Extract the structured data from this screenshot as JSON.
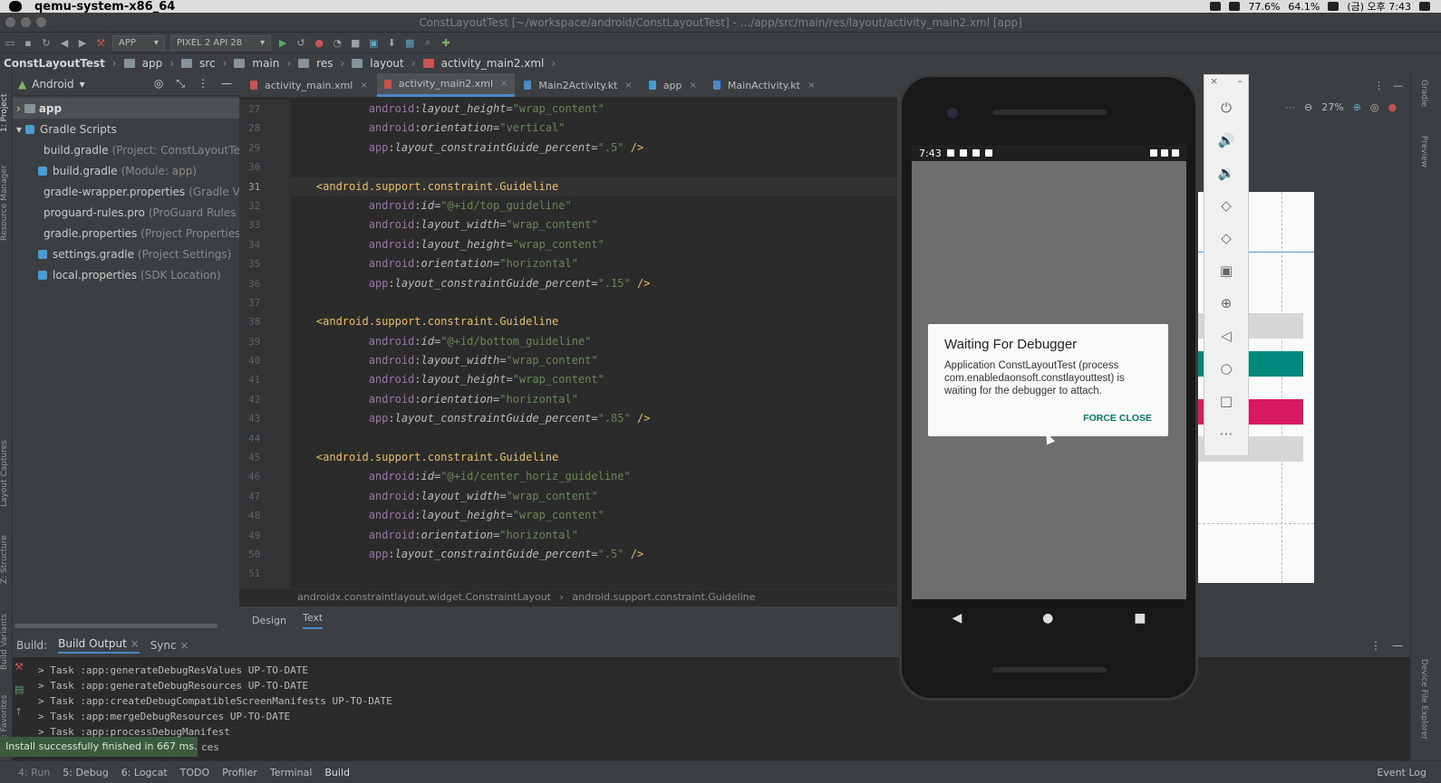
{
  "mac_menubar": {
    "app_name": "qemu-system-x86_64",
    "cpu": "77.6%",
    "mem": "64.1%",
    "clock": "(금) 오후 7:43"
  },
  "window": {
    "title": "ConstLayoutTest [~/workspace/android/ConstLayoutTest] - .../app/src/main/res/layout/activity_main2.xml [app]"
  },
  "toolbar": {
    "run_config": "APP",
    "device": "PIXEL 2 API 28"
  },
  "navbar": {
    "items": [
      "ConstLayoutTest",
      "app",
      "src",
      "main",
      "res",
      "layout",
      "activity_main2.xml"
    ]
  },
  "left_tools": {
    "project": "1: Project",
    "resource_manager": "Resource Manager",
    "layout_captures": "Layout Captures",
    "structure": "Z: Structure",
    "build_variants": "Build Variants",
    "favorites": "2: Favorites"
  },
  "project_panel": {
    "view": "Android",
    "tree": [
      {
        "label": "app",
        "hint": "",
        "sel": true
      },
      {
        "label": "Gradle Scripts",
        "hint": ""
      },
      {
        "label": "build.gradle",
        "hint": "(Project: ConstLayoutTest)"
      },
      {
        "label": "build.gradle",
        "hint": "(Module: app)"
      },
      {
        "label": "gradle-wrapper.properties",
        "hint": "(Gradle Versi"
      },
      {
        "label": "proguard-rules.pro",
        "hint": "(ProGuard Rules for a"
      },
      {
        "label": "gradle.properties",
        "hint": "(Project Properties)"
      },
      {
        "label": "settings.gradle",
        "hint": "(Project Settings)"
      },
      {
        "label": "local.properties",
        "hint": "(SDK Location)"
      }
    ]
  },
  "editor": {
    "tabs": [
      "activity_main.xml",
      "activity_main2.xml",
      "Main2Activity.kt",
      "app",
      "MainActivity.kt"
    ],
    "active_tab": 1,
    "line_numbers": [
      "27",
      "28",
      "29",
      "30",
      "31",
      "32",
      "33",
      "34",
      "35",
      "36",
      "37",
      "38",
      "39",
      "40",
      "41",
      "42",
      "43",
      "44",
      "45",
      "46",
      "47",
      "48",
      "49",
      "50",
      "51"
    ],
    "code": [
      {
        "indent": 1,
        "kind": "attr",
        "ns": "android",
        "name": "layout_height",
        "value": "\"wrap_content\""
      },
      {
        "indent": 1,
        "kind": "attr",
        "ns": "android",
        "name": "orientation",
        "value": "\"vertical\""
      },
      {
        "indent": 1,
        "kind": "attr",
        "ns": "app",
        "name": "layout_constraintGuide_percent",
        "value": "\".5\"",
        "close": " />"
      },
      {
        "indent": 0,
        "kind": "blank"
      },
      {
        "indent": 0,
        "kind": "tag",
        "text": "<android.support.constraint.Guideline",
        "hl": true
      },
      {
        "indent": 1,
        "kind": "attr",
        "ns": "android",
        "name": "id",
        "value": "\"@+id/top_guideline\""
      },
      {
        "indent": 1,
        "kind": "attr",
        "ns": "android",
        "name": "layout_width",
        "value": "\"wrap_content\""
      },
      {
        "indent": 1,
        "kind": "attr",
        "ns": "android",
        "name": "layout_height",
        "value": "\"wrap_content\""
      },
      {
        "indent": 1,
        "kind": "attr",
        "ns": "android",
        "name": "orientation",
        "value": "\"horizontal\""
      },
      {
        "indent": 1,
        "kind": "attr",
        "ns": "app",
        "name": "layout_constraintGuide_percent",
        "value": "\".15\"",
        "close": " />"
      },
      {
        "indent": 0,
        "kind": "blank"
      },
      {
        "indent": 0,
        "kind": "tag",
        "text": "<android.support.constraint.Guideline"
      },
      {
        "indent": 1,
        "kind": "attr",
        "ns": "android",
        "name": "id",
        "value": "\"@+id/bottom_guideline\""
      },
      {
        "indent": 1,
        "kind": "attr",
        "ns": "android",
        "name": "layout_width",
        "value": "\"wrap_content\""
      },
      {
        "indent": 1,
        "kind": "attr",
        "ns": "android",
        "name": "layout_height",
        "value": "\"wrap_content\""
      },
      {
        "indent": 1,
        "kind": "attr",
        "ns": "android",
        "name": "orientation",
        "value": "\"horizontal\""
      },
      {
        "indent": 1,
        "kind": "attr",
        "ns": "app",
        "name": "layout_constraintGuide_percent",
        "value": "\".85\"",
        "close": " />"
      },
      {
        "indent": 0,
        "kind": "blank"
      },
      {
        "indent": 0,
        "kind": "tag",
        "text": "<android.support.constraint.Guideline"
      },
      {
        "indent": 1,
        "kind": "attr",
        "ns": "android",
        "name": "id",
        "value": "\"@+id/center_horiz_guideline\""
      },
      {
        "indent": 1,
        "kind": "attr",
        "ns": "android",
        "name": "layout_width",
        "value": "\"wrap_content\""
      },
      {
        "indent": 1,
        "kind": "attr",
        "ns": "android",
        "name": "layout_height",
        "value": "\"wrap_content\""
      },
      {
        "indent": 1,
        "kind": "attr",
        "ns": "android",
        "name": "orientation",
        "value": "\"horizontal\""
      },
      {
        "indent": 1,
        "kind": "attr",
        "ns": "app",
        "name": "layout_constraintGuide_percent",
        "value": "\".5\"",
        "close": " />"
      },
      {
        "indent": 0,
        "kind": "blank"
      }
    ],
    "breadcrumb": [
      "androidx.constraintlayout.widget.ConstraintLayout",
      "android.support.constraint.Guideline"
    ],
    "bottom_tabs": [
      "Design",
      "Text"
    ],
    "active_bottom_tab": "Text"
  },
  "preview": {
    "zoom": "27%",
    "colors": {
      "teal": "#00897b",
      "pink": "#d81b60",
      "gray": "#d6d6d6"
    }
  },
  "build_panel": {
    "label": "Build:",
    "tabs": [
      "Build Output",
      "Sync"
    ],
    "lines": [
      "> Task :app:generateDebugResValues UP-TO-DATE",
      "> Task :app:generateDebugResources UP-TO-DATE",
      "> Task :app:createDebugCompatibleScreenManifests UP-TO-DATE",
      "> Task :app:mergeDebugResources UP-TO-DATE",
      "> Task :app:processDebugManifest",
      "ces"
    ],
    "toast": "Install successfully finished in 667 ms."
  },
  "statusbar": {
    "items": [
      "4: Run",
      "5: Debug",
      "6: Logcat",
      "TODO",
      "Profiler",
      "Terminal",
      "Build"
    ],
    "event_log": "Event Log"
  },
  "phone": {
    "time": "7:43",
    "dialog": {
      "title": "Waiting For Debugger",
      "message": "Application ConstLayoutTest (process com.enabledaonsoft.constlayouttest) is waiting for the debugger to attach.",
      "button": "FORCE CLOSE"
    }
  },
  "emulator_controls": [
    "power-icon",
    "volume-up-icon",
    "volume-down-icon",
    "rotate-left-icon",
    "rotate-right-icon",
    "camera-icon",
    "zoom-icon",
    "back-icon",
    "home-icon",
    "overview-icon",
    "more-icon"
  ],
  "right_strip": {
    "gradle": "Gradle",
    "preview": "Preview",
    "device_file_explorer": "Device File Explorer"
  }
}
